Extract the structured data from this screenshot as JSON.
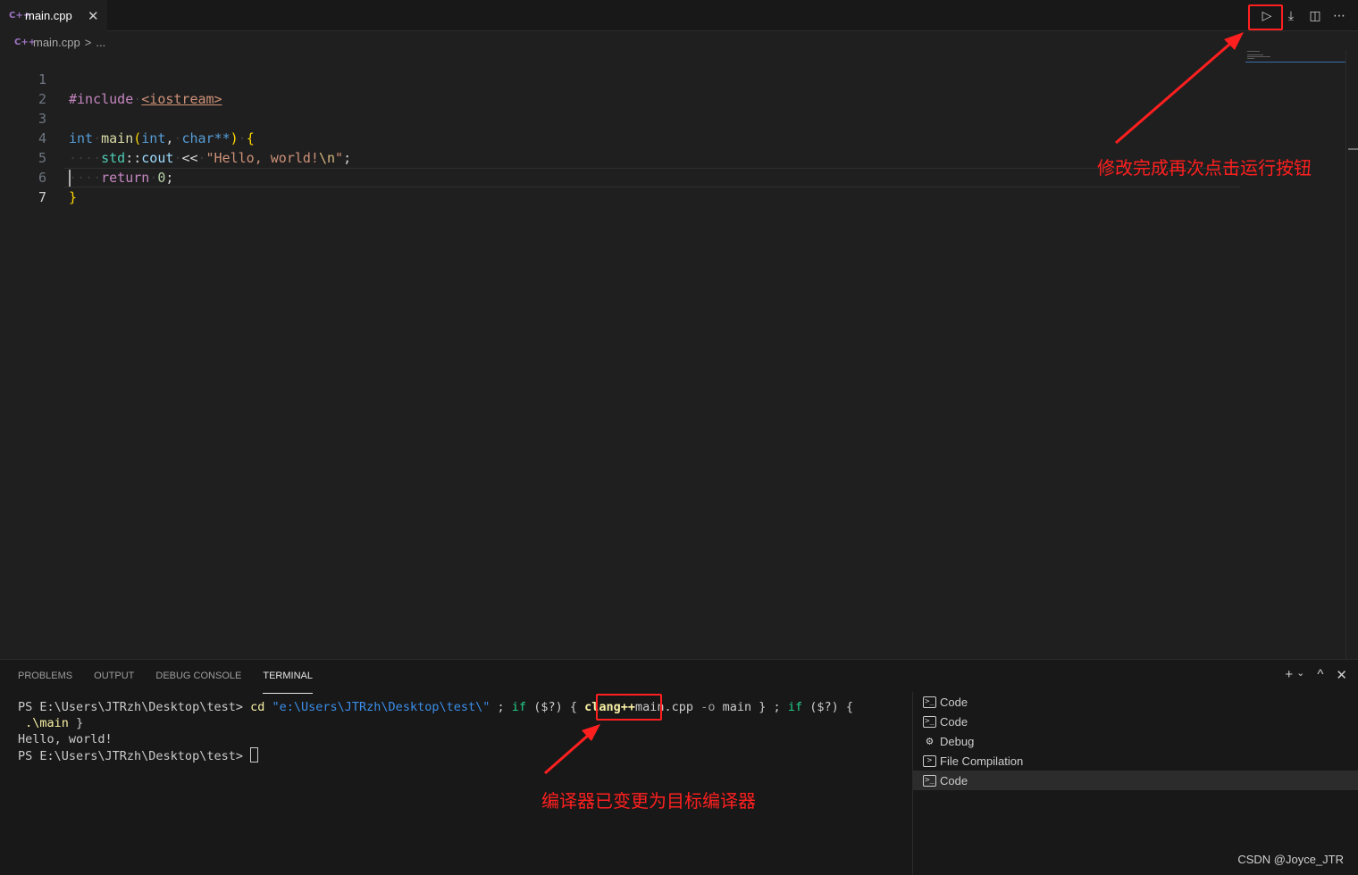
{
  "tab": {
    "icon": "C++",
    "label": "main.cpp",
    "close": "✕"
  },
  "toolbar": {
    "run": "▷",
    "run_dropdown": "⤓",
    "split": "◫",
    "more": "⋯"
  },
  "breadcrumb": {
    "icon": "C++",
    "file": "main.cpp",
    "sep": ">",
    "more": "..."
  },
  "editor": {
    "lines": [
      {
        "n": "1"
      },
      {
        "n": "2"
      },
      {
        "n": "3"
      },
      {
        "n": "4"
      },
      {
        "n": "5"
      },
      {
        "n": "6"
      },
      {
        "n": "7"
      }
    ],
    "l1": {
      "pre": "#include",
      "inc": "<iostream>"
    },
    "l3": {
      "kw1": "int",
      "fn": "main",
      "po": "(",
      "kw2": "int",
      "comma": ",",
      "kw3": "char",
      "ptr": "**",
      "pc": ")",
      "brace": "{"
    },
    "l4": {
      "ns": "std",
      "scope": "::",
      "var": "cout",
      "op": "<<",
      "str": "\"Hello, world!",
      "esc": "\\n",
      "strend": "\"",
      "semi": ";"
    },
    "l5": {
      "kw": "return",
      "num": "0",
      "semi": ";"
    },
    "l6": {
      "brace": "}"
    }
  },
  "annotations": {
    "top": "修改完成再次点击运行按钮",
    "bottom": "编译器已变更为目标编译器"
  },
  "panel": {
    "tabs": [
      "PROBLEMS",
      "OUTPUT",
      "DEBUG CONSOLE",
      "TERMINAL"
    ],
    "actions": {
      "add": "+",
      "dropdown": "⌄",
      "maximize": "^",
      "close": "✕"
    }
  },
  "terminal": {
    "prompt": "PS E:\\Users\\JTRzh\\Desktop\\test>",
    "cd": "cd",
    "path": "\"e:\\Users\\JTRzh\\Desktop\\test\\\"",
    "semi1": ";",
    "if1": "if",
    "cond1": "($?)",
    "open1": "{",
    "compiler": "clang++",
    "file": "main.cpp",
    "oflag": "-o",
    "out": "main",
    "close1": "}",
    "semi2": ";",
    "if2": "if",
    "cond2": "($?)",
    "open2": "{",
    "run": ".\\main",
    "close2": "}",
    "output": "Hello, world!",
    "prompt2": "PS E:\\Users\\JTRzh\\Desktop\\test>"
  },
  "terminal_list": [
    {
      "icon": ">_",
      "label": "Code"
    },
    {
      "icon": ">_",
      "label": "Code"
    },
    {
      "icon": "bug",
      "label": "Debug"
    },
    {
      "icon": ">",
      "label": "File Compilation"
    },
    {
      "icon": ">_",
      "label": "Code",
      "selected": true
    }
  ],
  "watermark": "CSDN @Joyce_JTR",
  "colors": {
    "annotation": "#ff1f1f",
    "editor_bg": "#1f1f1f",
    "panel_bg": "#181818"
  }
}
